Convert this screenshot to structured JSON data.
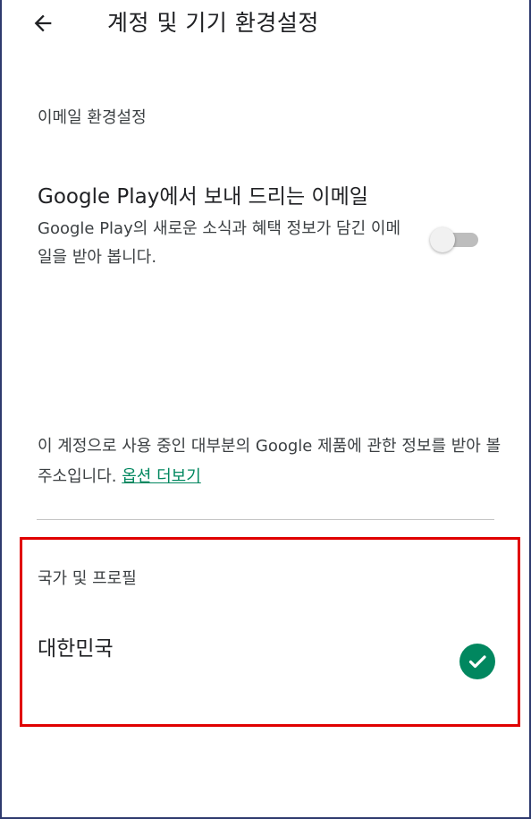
{
  "header": {
    "back_icon": "arrow-left-icon",
    "title": "계정 및 기기 환경설정"
  },
  "email_section": {
    "label": "이메일 환경설정",
    "pref_title": "Google Play에서 보내 드리는 이메일",
    "pref_desc": "Google Play의 새로운 소식과 혜택 정보가 담긴 이메일을 받아 봅니다.",
    "toggle_on": false
  },
  "info": {
    "text": "이 계정으로 사용 중인 대부분의 Google 제품에 관한 정보를 받아 볼 주소입니다. ",
    "link_label": "옵션 더보기"
  },
  "country_section": {
    "label": "국가 및 프로필",
    "value": "대한민국",
    "selected_icon": "check-circle-icon"
  },
  "colors": {
    "accent": "#01875f",
    "highlight": "#e00000"
  }
}
